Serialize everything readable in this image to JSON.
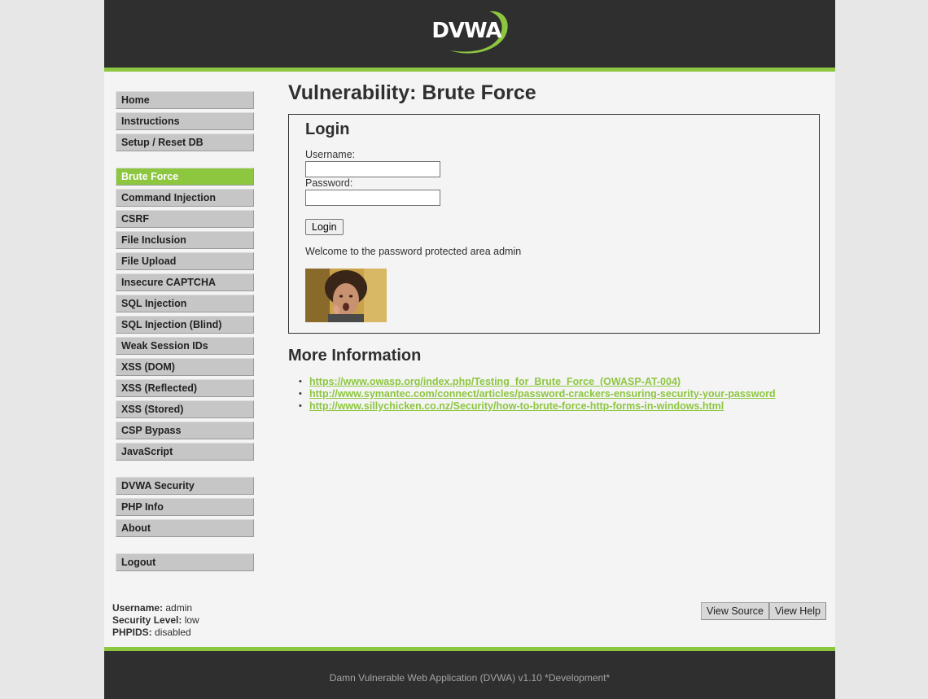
{
  "header": {
    "logo_text": "DVWA"
  },
  "menu": {
    "group1": [
      "Home",
      "Instructions",
      "Setup / Reset DB"
    ],
    "group2": [
      "Brute Force",
      "Command Injection",
      "CSRF",
      "File Inclusion",
      "File Upload",
      "Insecure CAPTCHA",
      "SQL Injection",
      "SQL Injection (Blind)",
      "Weak Session IDs",
      "XSS (DOM)",
      "XSS (Reflected)",
      "XSS (Stored)",
      "CSP Bypass",
      "JavaScript"
    ],
    "group3": [
      "DVWA Security",
      "PHP Info",
      "About"
    ],
    "group4": [
      "Logout"
    ],
    "selected": "Brute Force"
  },
  "main": {
    "title": "Vulnerability: Brute Force",
    "login": {
      "heading": "Login",
      "username_label": "Username:",
      "username_value": "",
      "password_label": "Password:",
      "password_value": "",
      "button": "Login",
      "welcome": "Welcome to the password protected area admin"
    },
    "more_info": {
      "heading": "More Information",
      "links": [
        "https://www.owasp.org/index.php/Testing_for_Brute_Force_(OWASP-AT-004)",
        "http://www.symantec.com/connect/articles/password-crackers-ensuring-security-your-password",
        "http://www.sillychicken.co.nz/Security/how-to-brute-force-http-forms-in-windows.html"
      ]
    }
  },
  "status": {
    "username_label": "Username:",
    "username": "admin",
    "security_label": "Security Level:",
    "security": "low",
    "phpids_label": "PHPIDS:",
    "phpids": "disabled"
  },
  "view_buttons": {
    "source": "View Source",
    "help": "View Help"
  },
  "footer": {
    "text": "Damn Vulnerable Web Application (DVWA) v1.10 *Development*"
  },
  "colors": {
    "accent": "#8dc63f",
    "header_bg": "#2f2f2f",
    "page_bg": "#f4f4f4",
    "menu_bg": "#c6c6c6"
  }
}
